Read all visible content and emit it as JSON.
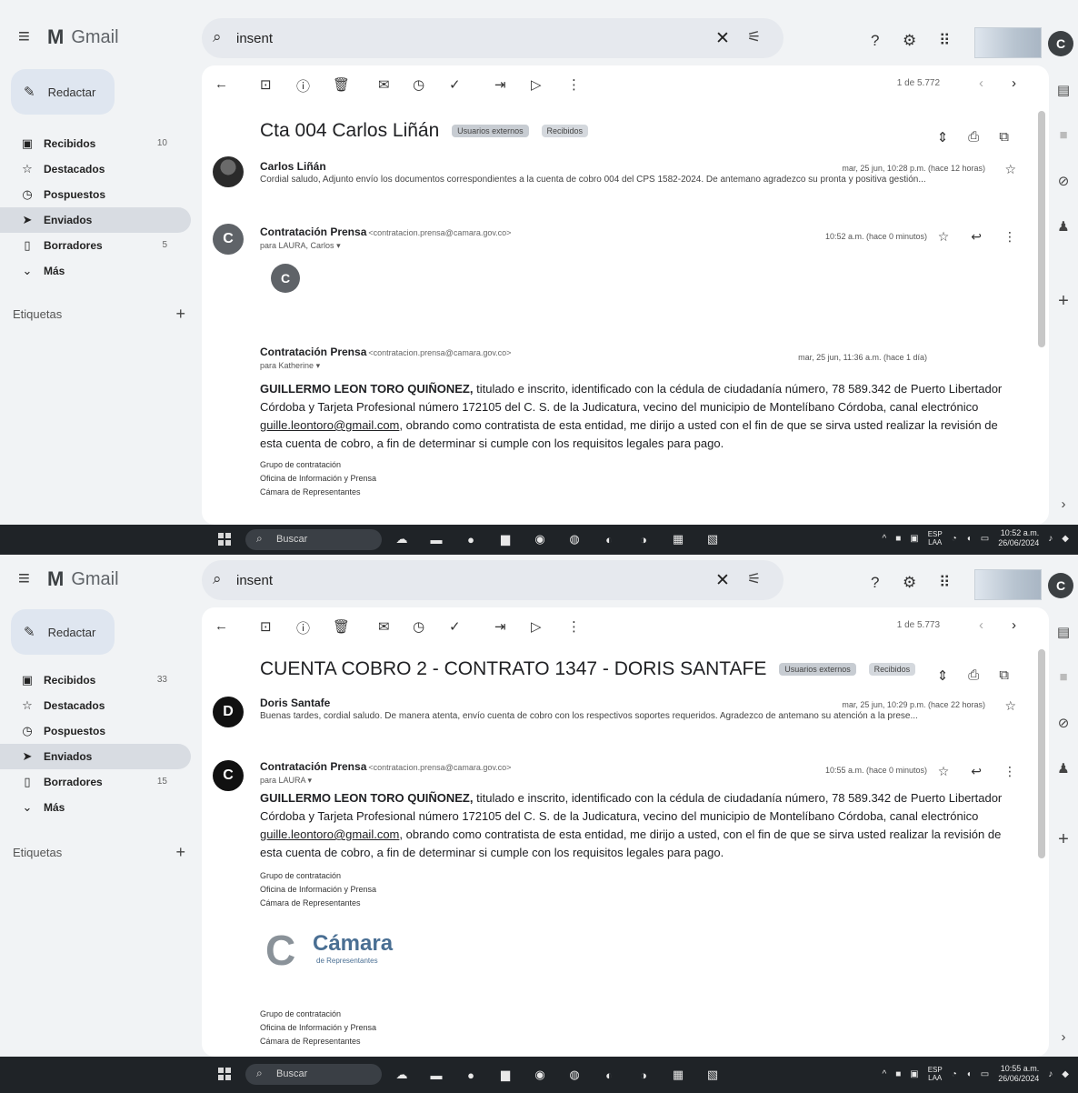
{
  "common": {
    "app_name": "Gmail",
    "search_value": "insent",
    "compose_label": "Redactar",
    "labels_heading": "Etiquetas",
    "nav_items": [
      {
        "label": "Recibidos",
        "icon": "inbox-icon"
      },
      {
        "label": "Destacados",
        "icon": "star-icon"
      },
      {
        "label": "Pospuestos",
        "icon": "clock-icon"
      },
      {
        "label": "Enviados",
        "icon": "send-icon"
      },
      {
        "label": "Borradores",
        "icon": "draft-icon"
      },
      {
        "label": "Más",
        "icon": "chevron-down-icon"
      }
    ],
    "taskbar_search": "Buscar"
  },
  "shot1": {
    "search_value": "insent",
    "pager": "1 de 5.772",
    "subject": "Cta 004 Carlos Liñán",
    "chips": [
      "Usuarios externos",
      "Recibidos"
    ],
    "nav_counts": [
      "10",
      "",
      "",
      "",
      "5",
      ""
    ],
    "msg1": {
      "sender": "Carlos Liñán",
      "snippet": "Cordial saludo, Adjunto envío los documentos correspondientes a la cuenta de cobro 004 del CPS 1582-2024. De antemano agradezco su pronta y positiva gestión...",
      "date": "mar, 25 jun, 10:28 p.m. (hace 12 horas)"
    },
    "msg2": {
      "sender": "Contratación Prensa",
      "email": "<contratacion.prensa@camara.gov.co>",
      "to": "para LAURA, Carlos",
      "date": "10:52 a.m. (hace 0 minutos)",
      "avatar": "C"
    },
    "msg3": {
      "sender": "Contratación Prensa",
      "email": "<contratacion.prensa@camara.gov.co>",
      "to": "para Katherine",
      "date": "mar, 25 jun, 11:36 a.m. (hace 1 día)"
    },
    "body_name": "GUILLERMO LEON TORO QUIÑONEZ,",
    "body_p1": " titulado e inscrito, identificado con la cédula de ciudadanía número, 78 589.342 de Puerto Libertador Córdoba y Tarjeta Profesional número 172105 del C. S. de la Judicatura, vecino del municipio de Montelíbano Córdoba, canal electrónico ",
    "body_link": "guille.leontoro@gmail.com",
    "body_p2": ", obrando como contratista de esta entidad, me dirijo a usted con el fin de que se sirva usted realizar la revisión de esta cuenta de cobro, a fin de determinar si cumple con los requisitos legales para pago.",
    "sig": [
      "Grupo de contratación",
      "Oficina de Información y Prensa",
      "Cámara de Representantes"
    ],
    "clock_time": "10:52 a.m.",
    "clock_date": "26/06/2024",
    "lang": [
      "ESP",
      "LAA"
    ]
  },
  "shot2": {
    "search_value": "insent",
    "pager": "1 de 5.773",
    "subject": "CUENTA COBRO 2 - CONTRATO 1347 - DORIS SANTAFE",
    "chips": [
      "Usuarios externos",
      "Recibidos"
    ],
    "nav_counts": [
      "33",
      "",
      "",
      "",
      "15",
      ""
    ],
    "msg1": {
      "sender": "Doris Santafe",
      "snippet": "Buenas tardes, cordial saludo. De manera atenta, envío cuenta de cobro con los respectivos soportes requeridos. Agradezco de antemano su atención a la prese...",
      "date": "mar, 25 jun, 10:29 p.m. (hace 22 horas)",
      "avatar": "D"
    },
    "msg2": {
      "sender": "Contratación Prensa",
      "email": "<contratacion.prensa@camara.gov.co>",
      "to": "para LAURA",
      "date": "10:55 a.m. (hace 0 minutos)",
      "avatar": "C"
    },
    "body_name": "GUILLERMO LEON TORO QUIÑONEZ,",
    "body_p1": " titulado e inscrito, identificado con la cédula de ciudadanía número, 78 589.342 de Puerto Libertador Córdoba y Tarjeta Profesional número 172105 del C. S. de la Judicatura, vecino del municipio de Montelíbano Córdoba, canal electrónico ",
    "body_link": "guille.leontoro@gmail.com",
    "body_p2": ", obrando como contratista de esta entidad, me dirijo a usted, con el fin de que se sirva usted realizar la revisión de esta cuenta de cobro, a fin de determinar si cumple con los requisitos legales para pago.",
    "sig": [
      "Grupo de contratación",
      "Oficina de Información y Prensa",
      "Cámara de Representantes"
    ],
    "logo_word": "Cámara",
    "logo_sub": "de Representantes",
    "sig2": [
      "Grupo de contratación",
      "Oficina de Información y Prensa",
      "Cámara de Representantes"
    ],
    "clock_time": "10:55 a.m.",
    "clock_date": "26/06/2024",
    "lang": [
      "ESP",
      "LAA"
    ]
  },
  "colors": {
    "background": "#f1f3f5",
    "pane": "#ffffff",
    "taskbar": "#1f2327",
    "active_nav": "#d8dce2"
  }
}
